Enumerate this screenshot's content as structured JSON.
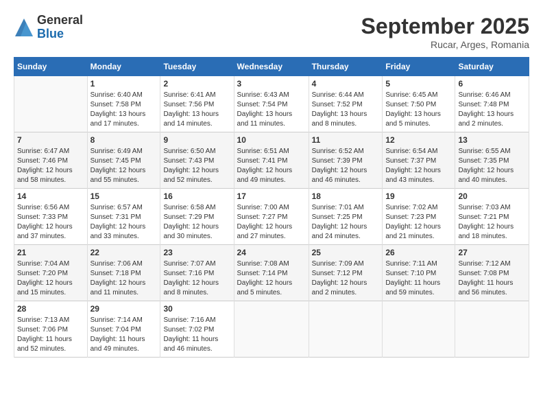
{
  "logo": {
    "general": "General",
    "blue": "Blue"
  },
  "title": "September 2025",
  "location": "Rucar, Arges, Romania",
  "days_of_week": [
    "Sunday",
    "Monday",
    "Tuesday",
    "Wednesday",
    "Thursday",
    "Friday",
    "Saturday"
  ],
  "weeks": [
    [
      {
        "day": "",
        "sunrise": "",
        "sunset": "",
        "daylight": ""
      },
      {
        "day": "1",
        "sunrise": "Sunrise: 6:40 AM",
        "sunset": "Sunset: 7:58 PM",
        "daylight": "Daylight: 13 hours and 17 minutes."
      },
      {
        "day": "2",
        "sunrise": "Sunrise: 6:41 AM",
        "sunset": "Sunset: 7:56 PM",
        "daylight": "Daylight: 13 hours and 14 minutes."
      },
      {
        "day": "3",
        "sunrise": "Sunrise: 6:43 AM",
        "sunset": "Sunset: 7:54 PM",
        "daylight": "Daylight: 13 hours and 11 minutes."
      },
      {
        "day": "4",
        "sunrise": "Sunrise: 6:44 AM",
        "sunset": "Sunset: 7:52 PM",
        "daylight": "Daylight: 13 hours and 8 minutes."
      },
      {
        "day": "5",
        "sunrise": "Sunrise: 6:45 AM",
        "sunset": "Sunset: 7:50 PM",
        "daylight": "Daylight: 13 hours and 5 minutes."
      },
      {
        "day": "6",
        "sunrise": "Sunrise: 6:46 AM",
        "sunset": "Sunset: 7:48 PM",
        "daylight": "Daylight: 13 hours and 2 minutes."
      }
    ],
    [
      {
        "day": "7",
        "sunrise": "Sunrise: 6:47 AM",
        "sunset": "Sunset: 7:46 PM",
        "daylight": "Daylight: 12 hours and 58 minutes."
      },
      {
        "day": "8",
        "sunrise": "Sunrise: 6:49 AM",
        "sunset": "Sunset: 7:45 PM",
        "daylight": "Daylight: 12 hours and 55 minutes."
      },
      {
        "day": "9",
        "sunrise": "Sunrise: 6:50 AM",
        "sunset": "Sunset: 7:43 PM",
        "daylight": "Daylight: 12 hours and 52 minutes."
      },
      {
        "day": "10",
        "sunrise": "Sunrise: 6:51 AM",
        "sunset": "Sunset: 7:41 PM",
        "daylight": "Daylight: 12 hours and 49 minutes."
      },
      {
        "day": "11",
        "sunrise": "Sunrise: 6:52 AM",
        "sunset": "Sunset: 7:39 PM",
        "daylight": "Daylight: 12 hours and 46 minutes."
      },
      {
        "day": "12",
        "sunrise": "Sunrise: 6:54 AM",
        "sunset": "Sunset: 7:37 PM",
        "daylight": "Daylight: 12 hours and 43 minutes."
      },
      {
        "day": "13",
        "sunrise": "Sunrise: 6:55 AM",
        "sunset": "Sunset: 7:35 PM",
        "daylight": "Daylight: 12 hours and 40 minutes."
      }
    ],
    [
      {
        "day": "14",
        "sunrise": "Sunrise: 6:56 AM",
        "sunset": "Sunset: 7:33 PM",
        "daylight": "Daylight: 12 hours and 37 minutes."
      },
      {
        "day": "15",
        "sunrise": "Sunrise: 6:57 AM",
        "sunset": "Sunset: 7:31 PM",
        "daylight": "Daylight: 12 hours and 33 minutes."
      },
      {
        "day": "16",
        "sunrise": "Sunrise: 6:58 AM",
        "sunset": "Sunset: 7:29 PM",
        "daylight": "Daylight: 12 hours and 30 minutes."
      },
      {
        "day": "17",
        "sunrise": "Sunrise: 7:00 AM",
        "sunset": "Sunset: 7:27 PM",
        "daylight": "Daylight: 12 hours and 27 minutes."
      },
      {
        "day": "18",
        "sunrise": "Sunrise: 7:01 AM",
        "sunset": "Sunset: 7:25 PM",
        "daylight": "Daylight: 12 hours and 24 minutes."
      },
      {
        "day": "19",
        "sunrise": "Sunrise: 7:02 AM",
        "sunset": "Sunset: 7:23 PM",
        "daylight": "Daylight: 12 hours and 21 minutes."
      },
      {
        "day": "20",
        "sunrise": "Sunrise: 7:03 AM",
        "sunset": "Sunset: 7:21 PM",
        "daylight": "Daylight: 12 hours and 18 minutes."
      }
    ],
    [
      {
        "day": "21",
        "sunrise": "Sunrise: 7:04 AM",
        "sunset": "Sunset: 7:20 PM",
        "daylight": "Daylight: 12 hours and 15 minutes."
      },
      {
        "day": "22",
        "sunrise": "Sunrise: 7:06 AM",
        "sunset": "Sunset: 7:18 PM",
        "daylight": "Daylight: 12 hours and 11 minutes."
      },
      {
        "day": "23",
        "sunrise": "Sunrise: 7:07 AM",
        "sunset": "Sunset: 7:16 PM",
        "daylight": "Daylight: 12 hours and 8 minutes."
      },
      {
        "day": "24",
        "sunrise": "Sunrise: 7:08 AM",
        "sunset": "Sunset: 7:14 PM",
        "daylight": "Daylight: 12 hours and 5 minutes."
      },
      {
        "day": "25",
        "sunrise": "Sunrise: 7:09 AM",
        "sunset": "Sunset: 7:12 PM",
        "daylight": "Daylight: 12 hours and 2 minutes."
      },
      {
        "day": "26",
        "sunrise": "Sunrise: 7:11 AM",
        "sunset": "Sunset: 7:10 PM",
        "daylight": "Daylight: 11 hours and 59 minutes."
      },
      {
        "day": "27",
        "sunrise": "Sunrise: 7:12 AM",
        "sunset": "Sunset: 7:08 PM",
        "daylight": "Daylight: 11 hours and 56 minutes."
      }
    ],
    [
      {
        "day": "28",
        "sunrise": "Sunrise: 7:13 AM",
        "sunset": "Sunset: 7:06 PM",
        "daylight": "Daylight: 11 hours and 52 minutes."
      },
      {
        "day": "29",
        "sunrise": "Sunrise: 7:14 AM",
        "sunset": "Sunset: 7:04 PM",
        "daylight": "Daylight: 11 hours and 49 minutes."
      },
      {
        "day": "30",
        "sunrise": "Sunrise: 7:16 AM",
        "sunset": "Sunset: 7:02 PM",
        "daylight": "Daylight: 11 hours and 46 minutes."
      },
      {
        "day": "",
        "sunrise": "",
        "sunset": "",
        "daylight": ""
      },
      {
        "day": "",
        "sunrise": "",
        "sunset": "",
        "daylight": ""
      },
      {
        "day": "",
        "sunrise": "",
        "sunset": "",
        "daylight": ""
      },
      {
        "day": "",
        "sunrise": "",
        "sunset": "",
        "daylight": ""
      }
    ]
  ]
}
